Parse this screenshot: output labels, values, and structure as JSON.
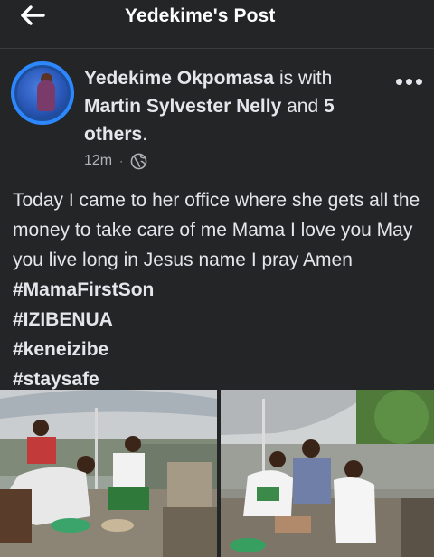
{
  "topbar": {
    "title": "Yedekime's Post",
    "back_icon": "arrow-left-icon"
  },
  "post": {
    "author": "Yedekime Okpomasa",
    "with_text": "is with",
    "tagged_person": "Martin Sylvester Nelly",
    "and_text": "and",
    "others": "5 others",
    "period": ".",
    "time": "12m",
    "separator": "·",
    "privacy_icon": "globe-icon",
    "more_icon": "more-horizontal-icon",
    "text_plain": "Today I came to her office where she gets all the money to take care of me Mama I love you May you live long in Jesus name I pray Amen",
    "hashtags": [
      "#MamaFirstSon",
      "#IZIBENUA",
      "#keneizibe",
      "#staysafe"
    ]
  },
  "colors": {
    "background": "#242526",
    "text": "#e4e6eb",
    "secondary_text": "#b0b3b8",
    "avatar_ring": "#2d88ff"
  }
}
